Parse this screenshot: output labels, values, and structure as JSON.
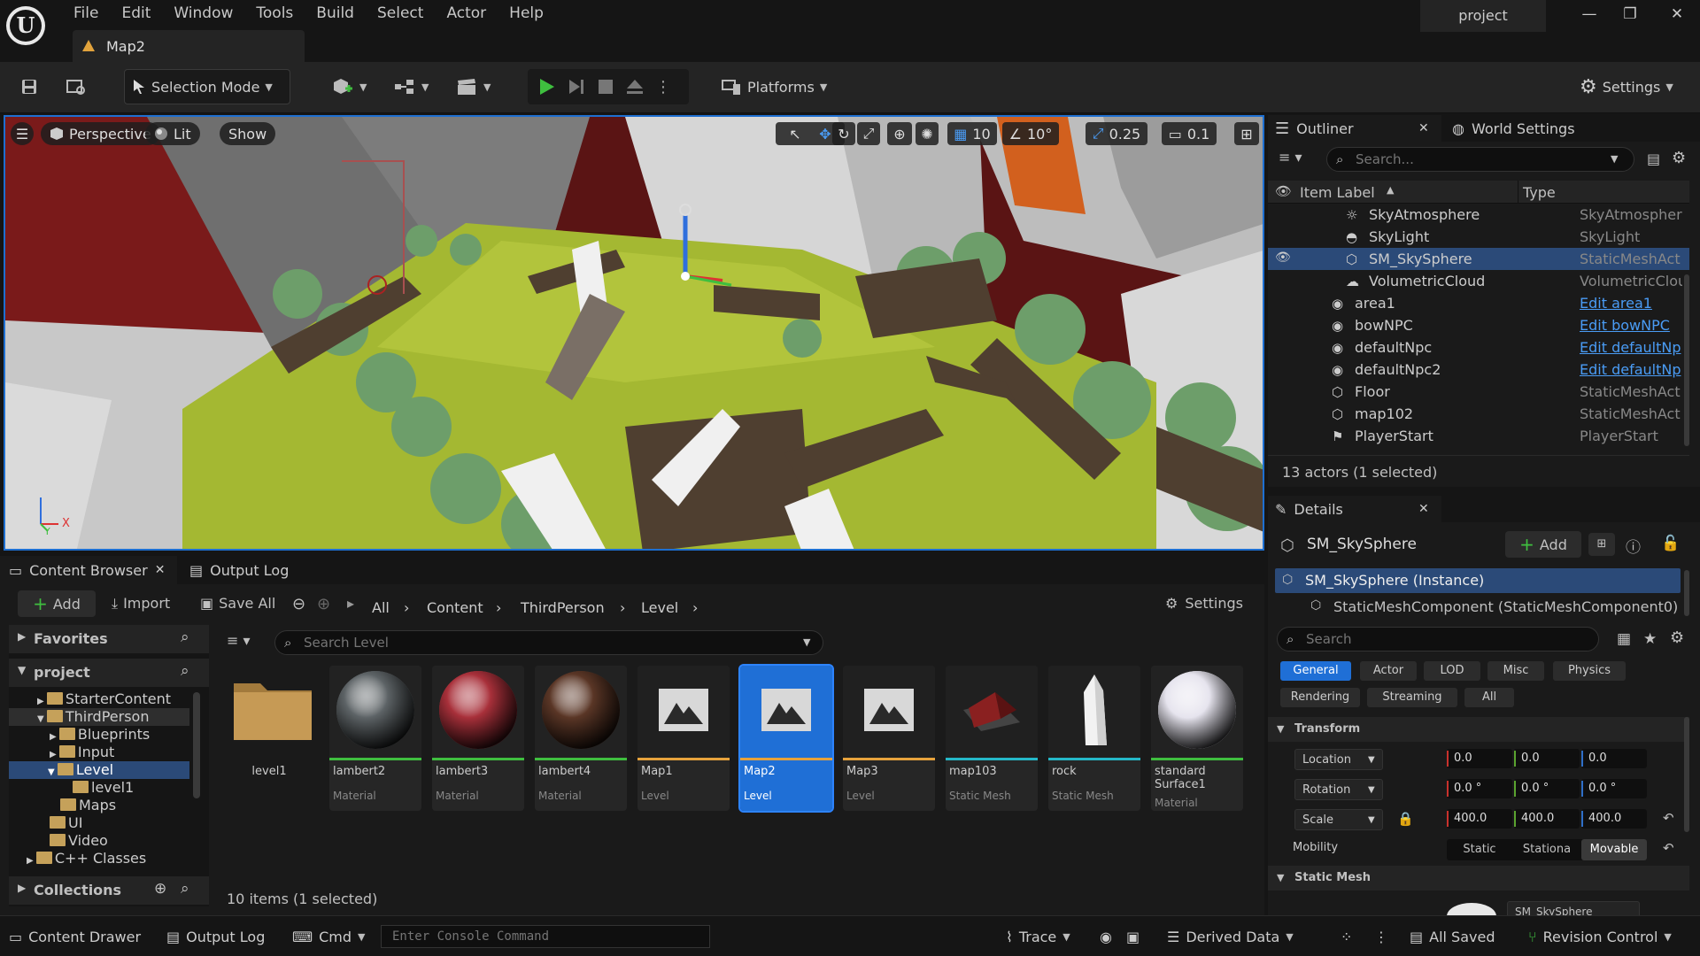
{
  "menu": [
    "File",
    "Edit",
    "Window",
    "Tools",
    "Build",
    "Select",
    "Actor",
    "Help"
  ],
  "map_tab": "Map2",
  "project_name": "project",
  "toolbar": {
    "selection_mode": "Selection Mode",
    "platforms": "Platforms",
    "settings": "Settings"
  },
  "viewport": {
    "perspective": "Perspective",
    "lit": "Lit",
    "show": "Show",
    "grid_snap": "10",
    "rot_snap": "10°",
    "scale_snap": "0.25",
    "cam_speed": "0.1",
    "axis_x": "X",
    "axis_y": "Y"
  },
  "outliner": {
    "tab": "Outliner",
    "world_tab": "World Settings",
    "search_placeholder": "Search...",
    "col_label": "Item Label",
    "col_type": "Type",
    "rows": [
      {
        "label": "SkyAtmosphere",
        "type": "SkyAtmospher",
        "icon": "sky-atmosphere-icon"
      },
      {
        "label": "SkyLight",
        "type": "SkyLight",
        "icon": "skylight-icon"
      },
      {
        "label": "SM_SkySphere",
        "type": "StaticMeshAct",
        "icon": "static-mesh-icon"
      },
      {
        "label": "VolumetricCloud",
        "type": "VolumetricClou",
        "icon": "cloud-icon"
      },
      {
        "label": "area1",
        "type": "Edit area1",
        "icon": "actor-icon"
      },
      {
        "label": "bowNPC",
        "type": "Edit bowNPC",
        "icon": "actor-icon"
      },
      {
        "label": "defaultNpc",
        "type": "Edit defaultNp",
        "icon": "actor-icon"
      },
      {
        "label": "defaultNpc2",
        "type": "Edit defaultNp",
        "icon": "actor-icon"
      },
      {
        "label": "Floor",
        "type": "StaticMeshAct",
        "icon": "static-mesh-icon"
      },
      {
        "label": "map102",
        "type": "StaticMeshAct",
        "icon": "static-mesh-icon"
      },
      {
        "label": "PlayerStart",
        "type": "PlayerStart",
        "icon": "player-start-icon"
      }
    ],
    "status": "13 actors (1 selected)"
  },
  "details": {
    "tab": "Details",
    "actor": "SM_SkySphere",
    "add": "Add",
    "instance": "SM_SkySphere (Instance)",
    "component": "StaticMeshComponent (StaticMeshComponent0)",
    "search_placeholder": "Search",
    "filters": [
      "General",
      "Actor",
      "LOD",
      "Misc",
      "Physics",
      "Rendering",
      "Streaming",
      "All"
    ],
    "transform_header": "Transform",
    "location": {
      "label": "Location",
      "x": "0.0",
      "y": "0.0",
      "z": "0.0"
    },
    "rotation": {
      "label": "Rotation",
      "x": "0.0 °",
      "y": "0.0 °",
      "z": "0.0 °"
    },
    "scale": {
      "label": "Scale",
      "x": "400.0",
      "y": "400.0",
      "z": "400.0"
    },
    "mobility": {
      "label": "Mobility",
      "options": [
        "Static",
        "Stationa",
        "Movable"
      ]
    },
    "static_mesh_header": "Static Mesh",
    "static_mesh_value": "SM_SkySphere"
  },
  "content_browser": {
    "tab": "Content Browser",
    "output_tab": "Output Log",
    "add": "Add",
    "import": "Import",
    "save_all": "Save All",
    "crumbs": [
      "All",
      "Content",
      "ThirdPerson",
      "Level"
    ],
    "settings": "Settings",
    "favorites": "Favorites",
    "project": "project",
    "tree": [
      "StarterContent",
      "ThirdPerson",
      "Blueprints",
      "Input",
      "Level",
      "level1",
      "Maps",
      "UI",
      "Video",
      "C++ Classes"
    ],
    "collections": "Collections",
    "search_placeholder": "Search Level",
    "items_count": "10 items (1 selected)",
    "assets": [
      {
        "name": "level1",
        "type": "",
        "kind": "folder"
      },
      {
        "name": "lambert2",
        "type": "Material",
        "kind": "sphere",
        "color": "#5d6366"
      },
      {
        "name": "lambert3",
        "type": "Material",
        "kind": "sphere",
        "color": "#a8303a"
      },
      {
        "name": "lambert4",
        "type": "Material",
        "kind": "sphere",
        "color": "#5a3626"
      },
      {
        "name": "Map1",
        "type": "Level",
        "kind": "level"
      },
      {
        "name": "Map2",
        "type": "Level",
        "kind": "level"
      },
      {
        "name": "Map3",
        "type": "Level",
        "kind": "level"
      },
      {
        "name": "map103",
        "type": "Static Mesh",
        "kind": "mesh"
      },
      {
        "name": "rock",
        "type": "Static Mesh",
        "kind": "rock"
      },
      {
        "name": "standard Surface1",
        "type": "Material",
        "kind": "sphere",
        "color": "#e6e4ee"
      }
    ]
  },
  "statusbar": {
    "content_drawer": "Content Drawer",
    "output_log": "Output Log",
    "cmd": "Cmd",
    "console_placeholder": "Enter Console Command",
    "trace": "Trace",
    "derived_data": "Derived Data",
    "all_saved": "All Saved",
    "revision_control": "Revision Control"
  }
}
